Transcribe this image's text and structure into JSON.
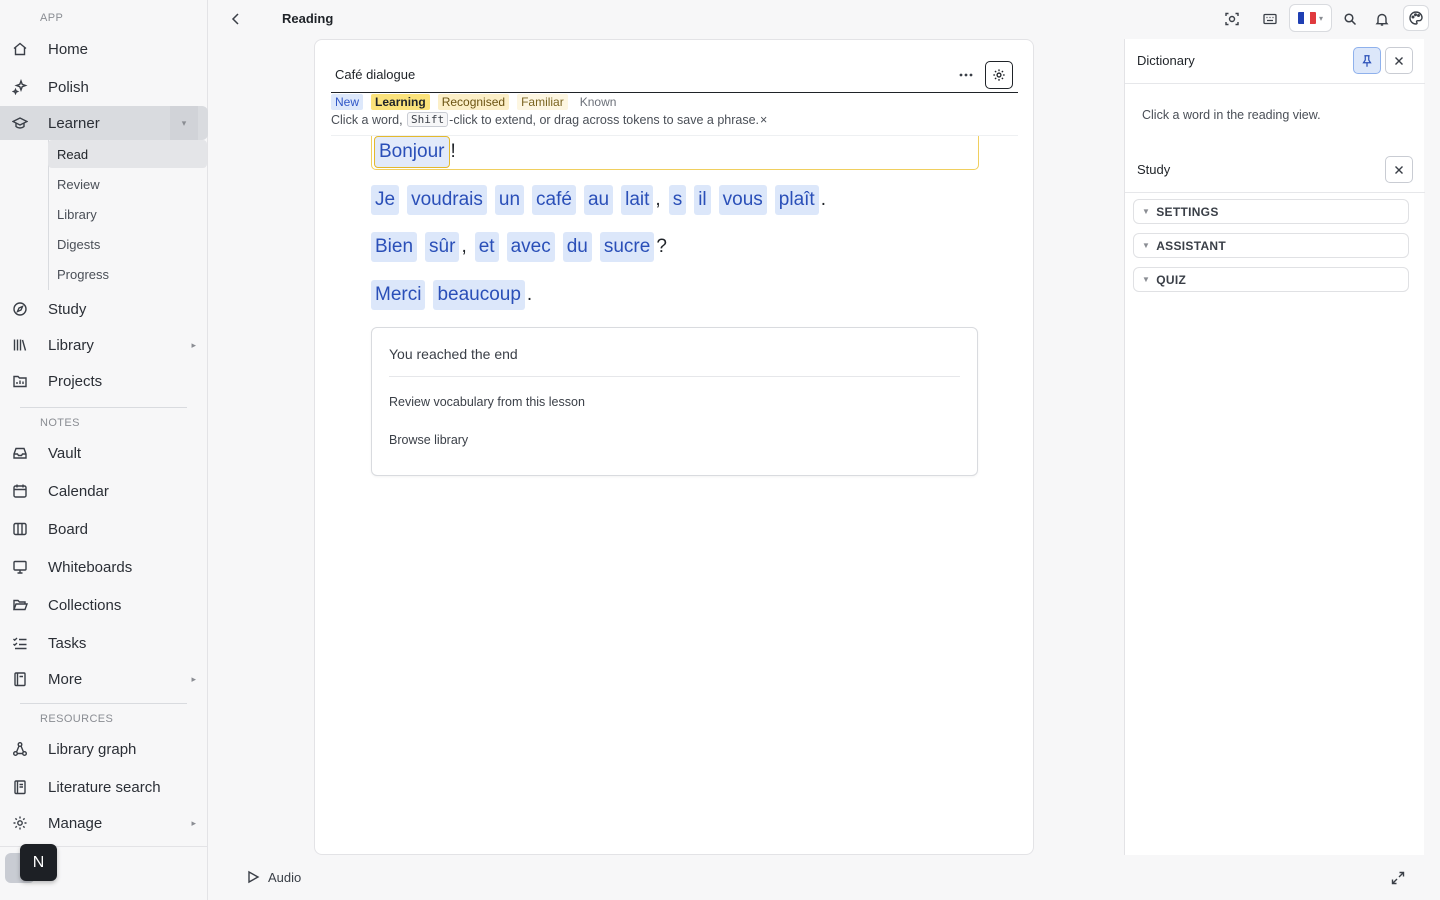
{
  "sidebar": {
    "sections": {
      "app": "APP",
      "notes": "NOTES",
      "resources": "RESOURCES"
    },
    "items": {
      "home": "Home",
      "polish": "Polish",
      "learner": "Learner",
      "study": "Study",
      "library": "Library",
      "projects": "Projects",
      "vault": "Vault",
      "calendar": "Calendar",
      "board": "Board",
      "whiteboards": "Whiteboards",
      "collections": "Collections",
      "tasks": "Tasks",
      "more": "More",
      "library_graph": "Library graph",
      "literature_search": "Literature search",
      "manage": "Manage"
    },
    "learner_sub": [
      "Read",
      "Review",
      "Library",
      "Digests",
      "Progress"
    ],
    "avatar_letter": "N"
  },
  "topbar": {
    "title": "Reading",
    "icons": [
      "focus-icon",
      "keyboard-icon",
      "flag-fr",
      "search-icon",
      "bell-icon",
      "palette-icon"
    ]
  },
  "reader": {
    "doc_title": "Café dialogue",
    "statuses": {
      "new": "New",
      "learning": "Learning",
      "recognised": "Recognised",
      "familiar": "Familiar",
      "known": "Known"
    },
    "hint": {
      "before": "Click a word,",
      "key": "Shift",
      "after": "-click to extend, or drag across tokens to save a phrase.",
      "close": "×"
    },
    "lines": [
      {
        "tokens": [
          "Bonjour"
        ],
        "punct": "!"
      },
      {
        "tokens": [
          "Je",
          "voudrais",
          "un",
          "café",
          "au",
          "lait"
        ],
        "punct1": ",",
        "tokens2": [
          "s",
          "il",
          "vous",
          "plaît"
        ],
        "punct": "."
      },
      {
        "tokens": [
          "Bien",
          "sûr"
        ],
        "punct1": ",",
        "tokens2": [
          "et",
          "avec",
          "du",
          "sucre"
        ],
        "punct": "?"
      },
      {
        "tokens": [
          "Merci",
          "beaucoup"
        ],
        "punct": "."
      }
    ],
    "end": {
      "title": "You reached the end",
      "review_link": "Review vocabulary from this lesson",
      "browse_link": "Browse library"
    }
  },
  "right_panel": {
    "dictionary_title": "Dictionary",
    "dictionary_empty": "Click a word in the reading view.",
    "study_title": "Study",
    "accordions": [
      "SETTINGS",
      "ASSISTANT",
      "QUIZ"
    ]
  },
  "bottombar": {
    "audio_label": "Audio"
  },
  "colors": {
    "accent_blue": "#2a4fb8",
    "token_bg": "#dce7fa",
    "learning_yellow": "#fbe27a",
    "recognised": "#fcefc7",
    "familiar": "#fdf6e1",
    "flag_blue": "#1f3fb3",
    "flag_red": "#e03a3e"
  }
}
